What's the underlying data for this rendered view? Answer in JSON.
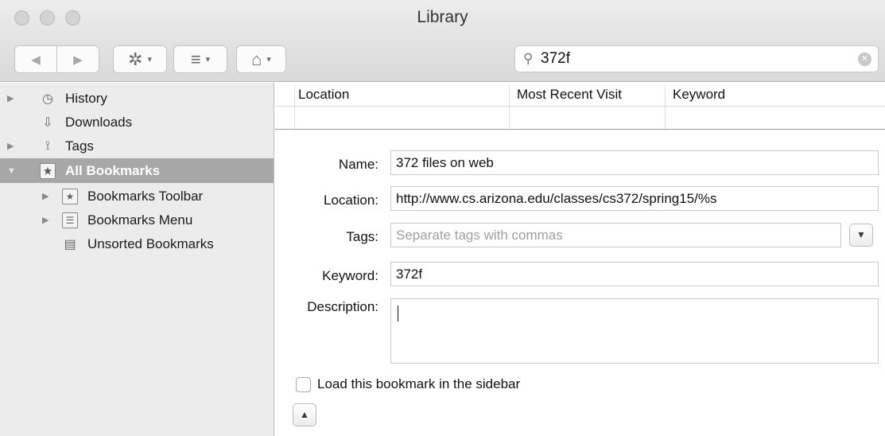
{
  "window": {
    "title": "Library"
  },
  "toolbar": {
    "back_icon": "back-arrow-icon",
    "forward_icon": "forward-arrow-icon",
    "organize_icon": "gear-icon",
    "views_icon": "list-icon",
    "import_icon": "home-star-icon",
    "back_glyph": "◀",
    "forward_glyph": "▶",
    "organize_glyph": "✲",
    "views_glyph": "≡",
    "import_glyph": "⌂",
    "caret_glyph": "▾"
  },
  "search": {
    "value": "372f",
    "icon": "search-icon",
    "glyph": "⚲",
    "clear_glyph": "✕"
  },
  "sidebar": {
    "items": [
      {
        "label": "History",
        "icon": "clock-icon",
        "glyph": "◷",
        "disclosure": "▶"
      },
      {
        "label": "Downloads",
        "icon": "download-arrow-icon",
        "glyph": "⇩",
        "disclosure": ""
      },
      {
        "label": "Tags",
        "icon": "tag-icon",
        "glyph": "⟟",
        "disclosure": "▶"
      },
      {
        "label": "All Bookmarks",
        "icon": "bookmarks-book-icon",
        "glyph": "★",
        "disclosure": "▼",
        "selected": true
      },
      {
        "label": "Bookmarks Toolbar",
        "icon": "star-box-icon",
        "glyph": "★",
        "disclosure": "▶"
      },
      {
        "label": "Bookmarks Menu",
        "icon": "menu-list-icon",
        "glyph": "☰",
        "disclosure": "▶"
      },
      {
        "label": "Unsorted Bookmarks",
        "icon": "tray-icon",
        "glyph": "▤",
        "disclosure": ""
      }
    ]
  },
  "table": {
    "columns": [
      "Location",
      "Most Recent Visit",
      "Keyword"
    ]
  },
  "details": {
    "name_label": "Name:",
    "name_value": "372 files on web",
    "location_label": "Location:",
    "location_value": "http://www.cs.arizona.edu/classes/cs372/spring15/%s",
    "tags_label": "Tags:",
    "tags_placeholder": "Separate tags with commas",
    "tags_dropdown_glyph": "▼",
    "keyword_label": "Keyword:",
    "keyword_value": "372f",
    "description_label": "Description:",
    "sidebar_checkbox_label": "Load this bookmark in the sidebar",
    "collapse_glyph": "▲"
  }
}
